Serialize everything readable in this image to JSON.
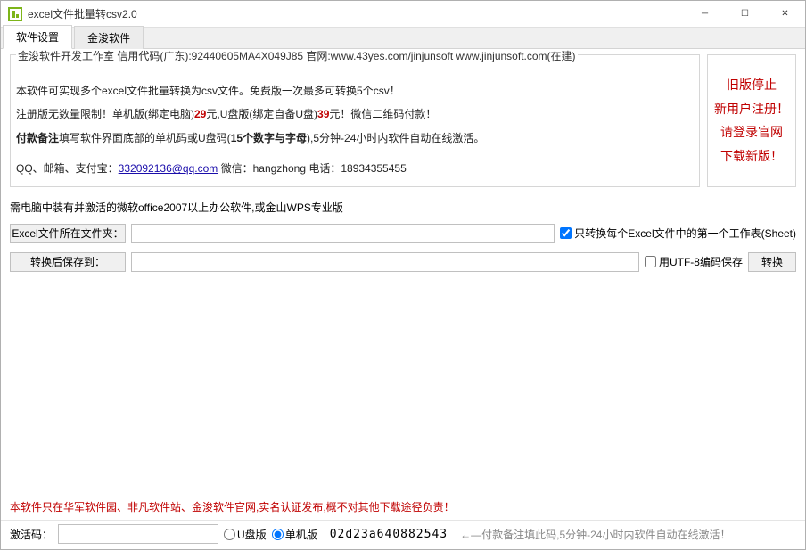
{
  "window": {
    "title": "excel文件批量转csv2.0"
  },
  "tabs": {
    "t1": "软件设置",
    "t2": "金浚软件"
  },
  "info": {
    "legend": "金浚软件开发工作室 信用代码(广东):92440605MA4X049J85 官网:www.43yes.com/jinjunsoft  www.jinjunsoft.com(在建)",
    "line1a": "本软件可实现多个excel文件批量转换为csv文件。免费版一次最多可转换5个csv！",
    "line2_pre": "注册版无数量限制！单机版(绑定电脑)",
    "line2_p1": "29",
    "line2_mid": "元,U盘版(绑定自备U盘)",
    "line2_p2": "39",
    "line2_post": "元！微信二维码付款！",
    "line3_pre": "付款备注",
    "line3_mid": "填写软件界面底部的单机码或U盘码(",
    "line3_code": "15个数字与字母",
    "line3_post": "),5分钟-24小时内软件自动在线激活。",
    "line4_pre": "QQ、邮箱、支付宝：",
    "line4_email": "332092136@qq.com",
    "line4_post": "  微信：hangzhong   电话：18934355455"
  },
  "side": {
    "l1": "旧版停止",
    "l2": "新用户注册！",
    "l3": "请登录官网",
    "l4": "下载新版！"
  },
  "req": "需电脑中装有并激活的微软office2007以上办公软件,或金山WPS专业版",
  "form": {
    "src_label": "Excel文件所在文件夹：",
    "src_value": "",
    "chk_first": "只转换每个Excel文件中的第一个工作表(Sheet)",
    "dst_label": "转换后保存到：",
    "dst_value": "",
    "chk_utf8": "用UTF-8编码保存",
    "convert_btn": "转换"
  },
  "warn": "本软件只在华军软件园、非凡软件站、金浚软件官网,实名认证发布,概不对其他下载途径负责！",
  "footer": {
    "act_label": "激活码：",
    "act_value": "",
    "radio_usb": "U盘版",
    "radio_single": "单机版",
    "machine_code": "02d23a640882543",
    "hint": "←—付款备注填此码,5分钟-24小时内软件自动在线激活！"
  }
}
